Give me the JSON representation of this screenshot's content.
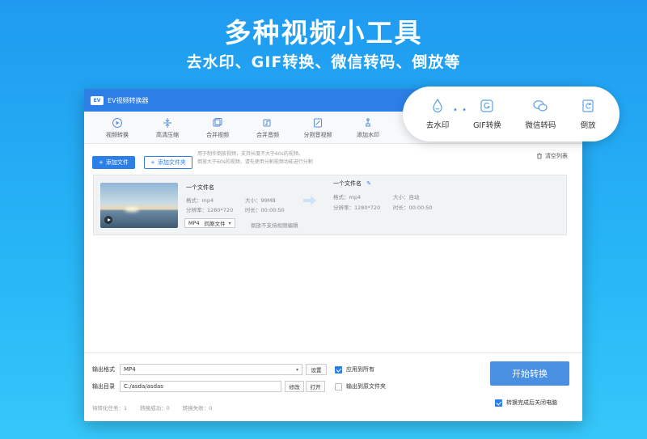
{
  "banner": {
    "title": "多种视频小工具",
    "subtitle": "去水印、GIF转换、微信转码、倒放等"
  },
  "window": {
    "title": "EV视频转换器",
    "logo_text": "EV"
  },
  "toolbar": {
    "items": [
      {
        "label": "视频转换",
        "icon": "convert-icon"
      },
      {
        "label": "高清压缩",
        "icon": "compress-icon"
      },
      {
        "label": "合并视频",
        "icon": "merge-video-icon"
      },
      {
        "label": "合并音频",
        "icon": "merge-audio-icon"
      },
      {
        "label": "分割音视频",
        "icon": "split-icon"
      },
      {
        "label": "添加水印",
        "icon": "watermark-icon"
      }
    ],
    "partial_label": "去"
  },
  "actions": {
    "add_file": "添加文件",
    "add_folder": "添加文件夹",
    "hint_line1": "用于制作倒放视频，支持长度不大于60s的视频。",
    "hint_line2": "倒放大于60s的视频，请先使用分割视频功能进行分割",
    "clear_list": "清空列表"
  },
  "file_item": {
    "source": {
      "name": "一个文件名",
      "format_label": "格式：",
      "format": "mp4",
      "size_label": "大小：",
      "size": "99MB",
      "resolution_label": "分辨率：",
      "resolution": "1280*720",
      "duration_label": "时长：",
      "duration": "00:00:50"
    },
    "target": {
      "name": "一个文件名",
      "format_label": "格式：",
      "format": "mp4",
      "size_label": "大小：",
      "size": "自动",
      "resolution_label": "分辨率：",
      "resolution": "1280*720",
      "duration_label": "时长：",
      "duration": "00:00:50"
    },
    "format_select": "MP4",
    "quality_select": "同原文件",
    "note": "倒放不支持视频编辑"
  },
  "bottom": {
    "output_format_label": "输出格式",
    "output_format_value": "MP4",
    "settings_button": "设置",
    "apply_all_label": "应用到所有",
    "apply_all_checked": true,
    "output_dir_label": "输出目录",
    "output_dir_value": "C:/asda/asdas",
    "modify_button": "修改",
    "open_button": "打开",
    "output_to_source_label": "输出到原文件夹",
    "output_to_source_checked": false,
    "start_button": "开始转换",
    "shutdown_label": "转换完成后关闭电脑",
    "shutdown_checked": true,
    "pending_label": "待转化任务：",
    "pending_count": "1",
    "success_label": "转换成功：",
    "success_count": "0",
    "fail_label": "转换失败：",
    "fail_count": "0"
  },
  "bubble": {
    "items": [
      {
        "label": "去水印",
        "icon": "droplet-icon"
      },
      {
        "label": "GIF转换",
        "icon": "gif-icon"
      },
      {
        "label": "微信转码",
        "icon": "wechat-icon"
      },
      {
        "label": "倒放",
        "icon": "reverse-icon"
      }
    ],
    "dots": "• •"
  },
  "colors": {
    "accent": "#2b7fe6",
    "start_button": "#4a90e2",
    "background_top": "#1f9af0",
    "background_bottom": "#36c7fa"
  }
}
